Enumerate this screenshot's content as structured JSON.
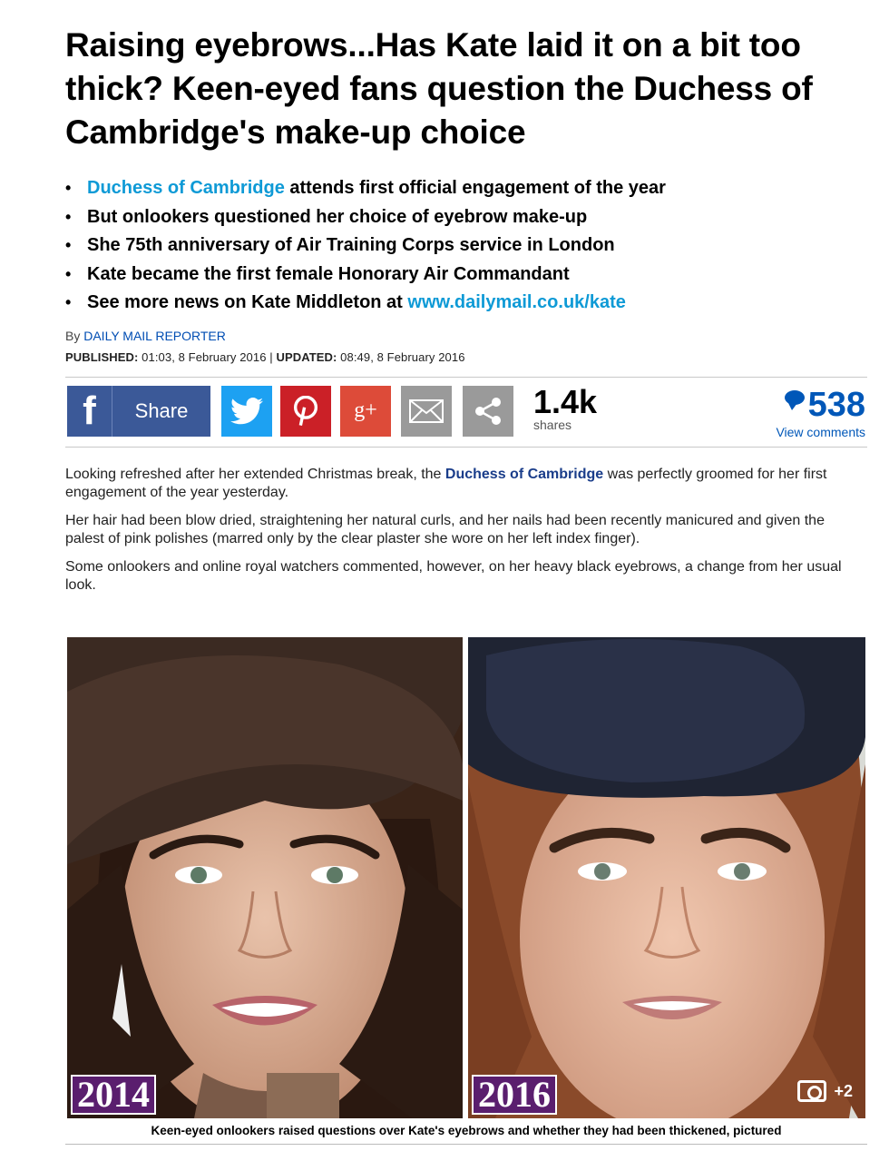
{
  "article": {
    "headline": "Raising eyebrows...Has Kate laid it on a bit too thick? Keen-eyed fans question the Duchess of Cambridge's make-up choice",
    "bullets": [
      {
        "link": "Duchess of Cambridge",
        "text": " attends first official engagement of the year"
      },
      {
        "text": "But onlookers questioned her choice of eyebrow make-up"
      },
      {
        "text": "She 75th anniversary of Air Training Corps service in London"
      },
      {
        "text": "Kate became the first female Honorary Air Commandant"
      },
      {
        "text": "See more news on Kate Middleton at ",
        "link": "www.dailymail.co.uk/kate"
      }
    ],
    "byline_prefix": "By",
    "reporter": "DAILY MAIL REPORTER",
    "published_label": "PUBLISHED:",
    "published": "01:03, 8 February 2016",
    "separator": "|",
    "updated_label": "UPDATED:",
    "updated": "08:49, 8 February 2016",
    "paragraph1": {
      "pre": "Looking refreshed after her extended Christmas break, the ",
      "link": "Duchess of Cambridge",
      "post": " was perfectly groomed for her first engagement of the year yesterday."
    },
    "paragraph2": "Her hair had been blow dried, straightening her natural curls, and her nails had been recently manicured and given the palest of pink polishes (marred only by the clear plaster she wore on her left index finger).",
    "paragraph3": "Some onlookers and online royal watchers commented, however, on her heavy black eyebrows, a change from her usual look.",
    "photo_left_year": "2014",
    "photo_right_year": "2016",
    "more_photos": "+2",
    "caption": "Keen-eyed onlookers raised questions over Kate's eyebrows and whether they had been thickened, pictured"
  },
  "share": {
    "facebook_icon": "f",
    "facebook_label": "Share",
    "googleplus_label": "g+",
    "count": "1.4k",
    "count_label": "shares",
    "comments_count": "538",
    "comments_label": "View comments"
  },
  "icons": [
    "facebook-icon",
    "twitter-icon",
    "pinterest-icon",
    "google-plus-icon",
    "email-icon",
    "share-icon",
    "comment-bubble-icon",
    "camera-icon"
  ],
  "colors": {
    "link_cyan": "#0e9ad6",
    "link_blue": "#0057b8",
    "facebook": "#3b5998",
    "twitter": "#1da1f2",
    "pinterest": "#cb2027",
    "googleplus": "#dd4b39",
    "grey_button": "#9a9a9a",
    "year_badge": "#5a1e6e"
  }
}
